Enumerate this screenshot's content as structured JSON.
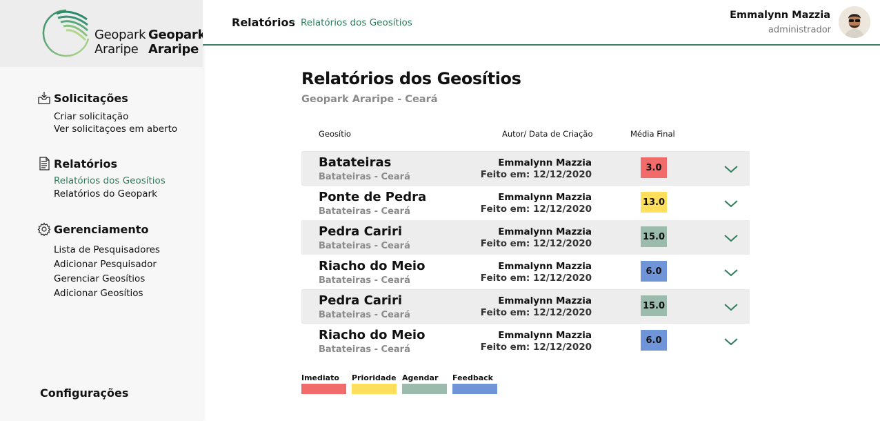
{
  "logo": {
    "line1": "Geopark",
    "line2": "Araripe"
  },
  "sidebar": {
    "sections": [
      {
        "title": "Solicitações",
        "icon": "inbox-download-icon",
        "items": [
          {
            "label": "Criar solicitação"
          },
          {
            "label": "Ver solicitaçoes em aberto"
          }
        ]
      },
      {
        "title": "Relatórios",
        "icon": "document-icon",
        "items": [
          {
            "label": "Relatórios dos Geosítios"
          },
          {
            "label": "Relatórios do Geopark"
          }
        ]
      },
      {
        "title": "Gerenciamento",
        "icon": "gear-icon",
        "items": [
          {
            "label": "Lista de Pesquisadores"
          },
          {
            "label": "Adicionar Pesquisador"
          },
          {
            "label": "Gerenciar Geosítios"
          },
          {
            "label": "Adicionar Geosítios"
          }
        ]
      }
    ],
    "config_label": "Configurações"
  },
  "breadcrumb": {
    "root": "Relatórios",
    "sep": "›",
    "current": "Relatórios dos Geosítios"
  },
  "user": {
    "name": "Emmalynn Mazzia",
    "role": "administrador"
  },
  "page": {
    "title": "Relatórios dos Geosítios",
    "subtitle": "Geopark Araripe - Ceará"
  },
  "table": {
    "headers": {
      "geosite": "Geosítio",
      "author": "Autor/ Data de Criação",
      "score": "Média Final"
    },
    "rows": [
      {
        "name": "Batateiras",
        "location": "Batateiras - Ceará",
        "author": "Emmalynn Mazzia",
        "date": "Feito em: 12/12/2020",
        "score": "3.0",
        "category": "Imediato"
      },
      {
        "name": "Ponte de Pedra",
        "location": "Batateiras - Ceará",
        "author": "Emmalynn Mazzia",
        "date": "Feito em: 12/12/2020",
        "score": "13.0",
        "category": "Prioridade"
      },
      {
        "name": "Pedra Cariri",
        "location": "Batateiras - Ceará",
        "author": "Emmalynn Mazzia",
        "date": "Feito em: 12/12/2020",
        "score": "15.0",
        "category": "Agendar"
      },
      {
        "name": "Riacho do Meio",
        "location": "Batateiras - Ceará",
        "author": "Emmalynn Mazzia",
        "date": "Feito em: 12/12/2020",
        "score": "6.0",
        "category": "Feedback"
      },
      {
        "name": "Pedra Cariri",
        "location": "Batateiras - Ceará",
        "author": "Emmalynn Mazzia",
        "date": "Feito em: 12/12/2020",
        "score": "15.0",
        "category": "Agendar"
      },
      {
        "name": "Riacho do Meio",
        "location": "Batateiras - Ceará",
        "author": "Emmalynn Mazzia",
        "date": "Feito em: 12/12/2020",
        "score": "6.0",
        "category": "Feedback"
      }
    ]
  },
  "legend": [
    {
      "label": "Imediato",
      "color": "#f26b6b"
    },
    {
      "label": "Prioridade",
      "color": "#fddf5c"
    },
    {
      "label": "Agendar",
      "color": "#9bbcad"
    },
    {
      "label": "Feedback",
      "color": "#7094d8"
    }
  ],
  "colors": {
    "accent": "#2e7d5b",
    "row_shade": "#ededed"
  }
}
